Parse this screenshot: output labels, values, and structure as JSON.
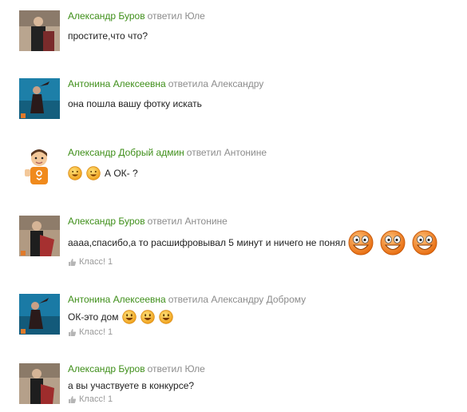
{
  "comments": [
    {
      "author": "Александр Буров",
      "replied": "ответил Юле",
      "text": "простите,что что?"
    },
    {
      "author": "Антонина Алексеевна",
      "replied": "ответила Александру",
      "text": "она пошла вашу фотку искать"
    },
    {
      "author": "Александр Добрый админ",
      "replied": "ответил Антонине",
      "text": "А ОК- ?"
    },
    {
      "author": "Александр Буров",
      "replied": "ответил Антонине",
      "text": "аааа,спасибо,а то расшифровывал 5 минут и ничего не понял",
      "like": "Класс! 1"
    },
    {
      "author": "Антонина Алексеевна",
      "replied": "ответила Александру Доброму",
      "text": "ОК-это дом",
      "like": "Класс! 1"
    },
    {
      "author": "Александр Буров",
      "replied": "ответил Юле",
      "text": "а вы участвуете в конкурсе?",
      "like": "Класс! 1"
    }
  ],
  "colors": {
    "author": "#3f8f1a",
    "muted": "#8c8c8c",
    "text": "#222222",
    "smile": "#f5a623"
  }
}
